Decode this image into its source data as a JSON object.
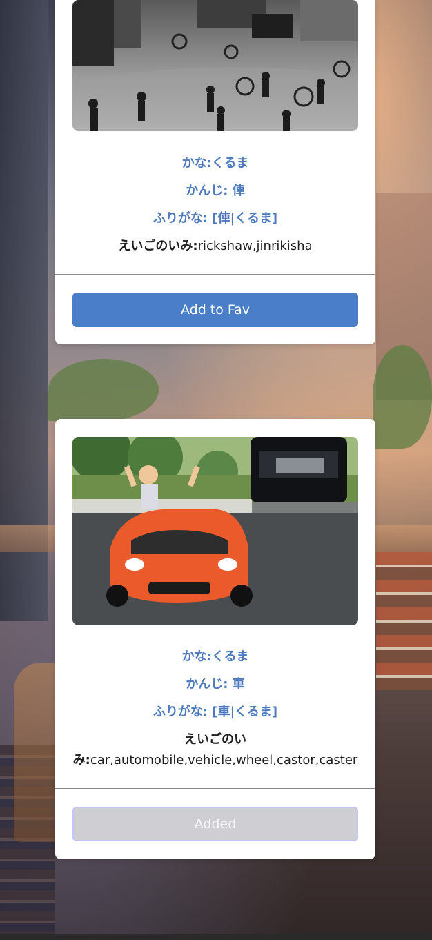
{
  "cards": [
    {
      "kana": "かな:くるま",
      "kanji": "かんじ: 俥",
      "furigana": "ふりがな: [俥|くるま]",
      "meaning_label": "えいごのいみ:",
      "meaning_value": "rickshaw,jinrikisha",
      "button_label": "Add to Fav"
    },
    {
      "kana": "かな:くるま",
      "kanji": "かんじ: 車",
      "furigana": "ふりがな: [車|くるま]",
      "meaning_label": "えいごのいみ:",
      "meaning_value": "car,automobile,vehicle,wheel,castor,caster",
      "button_label": "Added"
    }
  ]
}
